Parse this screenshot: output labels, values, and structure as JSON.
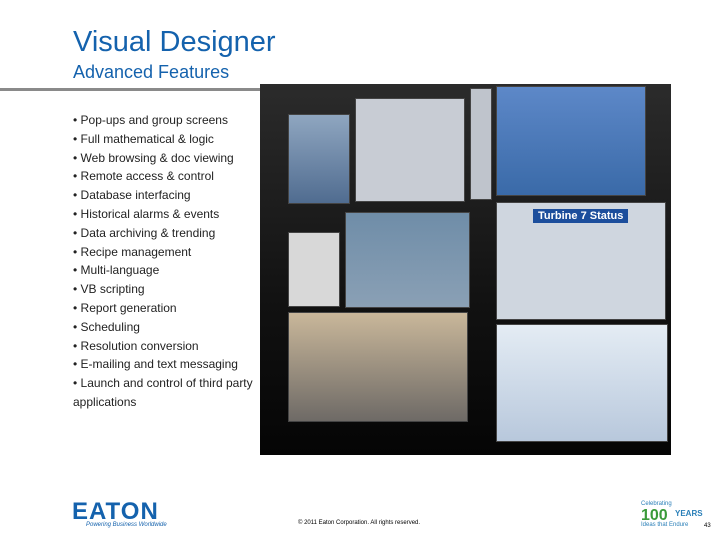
{
  "header": {
    "title": "Visual Designer",
    "subtitle": "Advanced Features"
  },
  "features": [
    "• Pop-ups and group screens",
    "• Full mathematical & logic",
    "• Web browsing & doc viewing",
    "• Remote access & control",
    "• Database interfacing",
    "• Historical alarms & events",
    "• Data archiving & trending",
    "• Recipe management",
    "• Multi-language",
    "• VB scripting",
    "• Report generation",
    "• Scheduling",
    "• Resolution conversion",
    "• E-mailing and text messaging",
    "• Launch and control of third party applications"
  ],
  "photo": {
    "screen_label": "Turbine 7 Status"
  },
  "footer": {
    "logo": "EATON",
    "tagline": "Powering Business Worldwide",
    "copyright": "© 2011 Eaton Corporation. All rights reserved.",
    "celebrating": "Celebrating",
    "hundred": "100",
    "years": "YEARS",
    "ideas": "Ideas that Endure",
    "page": "43"
  },
  "colors": {
    "brand_blue": "#1462ad",
    "rule_gray": "#8a8a8a"
  }
}
